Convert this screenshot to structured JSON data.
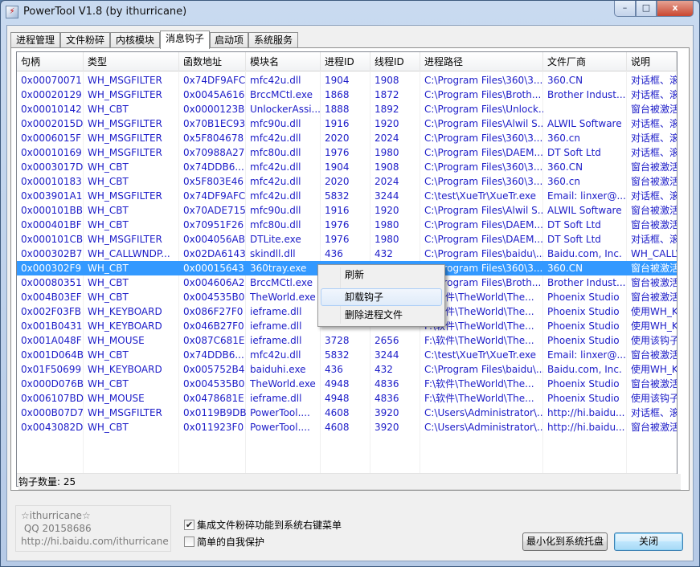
{
  "window": {
    "title": "PowerTool V1.8 (by ithurricane)",
    "app_icon": "app-icon",
    "min": "–",
    "max": "□",
    "close": "x"
  },
  "tabs": [
    "进程管理",
    "文件粉碎",
    "内核模块",
    "消息钩子",
    "启动项",
    "系统服务"
  ],
  "active_tab": 3,
  "columns": [
    "句柄",
    "类型",
    "函数地址",
    "模块名",
    "进程ID",
    "线程ID",
    "进程路径",
    "文件厂商",
    "说明"
  ],
  "rows": [
    [
      "0x00070071",
      "WH_MSGFILTER",
      "0x74DF9AFC",
      "mfc42u.dll",
      "1904",
      "1908",
      "C:\\Program Files\\360\\3...",
      "360.CN",
      "对话框、滚"
    ],
    [
      "0x00020129",
      "WH_MSGFILTER",
      "0x0045A616",
      "BrccMCtl.exe",
      "1868",
      "1872",
      "C:\\Program Files\\Broth...",
      "Brother Indust...",
      "对话框、滚"
    ],
    [
      "0x00010142",
      "WH_CBT",
      "0x0000123B",
      "UnlockerAssi...",
      "1888",
      "1892",
      "C:\\Program Files\\Unlock...",
      "",
      "窗台被激活"
    ],
    [
      "0x0002015D",
      "WH_MSGFILTER",
      "0x70B1EC93",
      "mfc90u.dll",
      "1916",
      "1920",
      "C:\\Program Files\\Alwil S...",
      "ALWIL Software",
      "对话框、滚"
    ],
    [
      "0x0006015F",
      "WH_MSGFILTER",
      "0x5F804678",
      "mfc42u.dll",
      "2020",
      "2024",
      "C:\\Program Files\\360\\3...",
      "360.cn",
      "对话框、滚"
    ],
    [
      "0x00010169",
      "WH_MSGFILTER",
      "0x70988A27",
      "mfc80u.dll",
      "1976",
      "1980",
      "C:\\Program Files\\DAEM...",
      "DT Soft Ltd",
      "对话框、滚"
    ],
    [
      "0x0003017D",
      "WH_CBT",
      "0x74DDB6...",
      "mfc42u.dll",
      "1904",
      "1908",
      "C:\\Program Files\\360\\3...",
      "360.CN",
      "窗台被激活"
    ],
    [
      "0x00010183",
      "WH_CBT",
      "0x5F803E46",
      "mfc42u.dll",
      "2020",
      "2024",
      "C:\\Program Files\\360\\3...",
      "360.cn",
      "窗台被激活"
    ],
    [
      "0x003901A1",
      "WH_MSGFILTER",
      "0x74DF9AFC",
      "mfc42u.dll",
      "5832",
      "3244",
      "C:\\test\\XueTr\\XueTr.exe",
      "Email: linxer@...",
      "对话框、滚"
    ],
    [
      "0x000101BB",
      "WH_CBT",
      "0x70ADE715",
      "mfc90u.dll",
      "1916",
      "1920",
      "C:\\Program Files\\Alwil S...",
      "ALWIL Software",
      "窗台被激活"
    ],
    [
      "0x000401BF",
      "WH_CBT",
      "0x70951F26",
      "mfc80u.dll",
      "1976",
      "1980",
      "C:\\Program Files\\DAEM...",
      "DT Soft Ltd",
      "窗台被激活"
    ],
    [
      "0x000101CB",
      "WH_MSGFILTER",
      "0x004056AB",
      "DTLite.exe",
      "1976",
      "1980",
      "C:\\Program Files\\DAEM...",
      "DT Soft Ltd",
      "对话框、滚"
    ],
    [
      "0x000302B7",
      "WH_CALLWNDP...",
      "0x02DA6143",
      "skindll.dll",
      "436",
      "432",
      "C:\\Program Files\\baidu\\...",
      "Baidu.com, Inc.",
      "WH_CALLW"
    ],
    [
      "0x000302F9",
      "WH_CBT",
      "0x00015643",
      "360tray.exe",
      "1904",
      "1908",
      "C:\\Program Files\\360\\3...",
      "360.CN",
      "窗台被激活"
    ],
    [
      "0x00080351",
      "WH_CBT",
      "0x004606A2",
      "BrccMCtl.exe",
      "",
      "",
      "C:\\Program Files\\Broth...",
      "Brother Indust...",
      "窗台被激活"
    ],
    [
      "0x004B03EF",
      "WH_CBT",
      "0x004535B0",
      "TheWorld.exe",
      "",
      "",
      "F:\\软件\\TheWorld\\The...",
      "Phoenix Studio",
      "窗台被激活"
    ],
    [
      "0x002F03FB",
      "WH_KEYBOARD",
      "0x086F27F0",
      "ieframe.dll",
      "",
      "",
      "F:\\软件\\TheWorld\\The...",
      "Phoenix Studio",
      "使用WH_K"
    ],
    [
      "0x001B0431",
      "WH_KEYBOARD",
      "0x046B27F0",
      "ieframe.dll",
      "",
      "",
      "F:\\软件\\TheWorld\\The...",
      "Phoenix Studio",
      "使用WH_K"
    ],
    [
      "0x001A048F",
      "WH_MOUSE",
      "0x087C681E",
      "ieframe.dll",
      "3728",
      "2656",
      "F:\\软件\\TheWorld\\The...",
      "Phoenix Studio",
      "使用该钩子"
    ],
    [
      "0x001D064B",
      "WH_CBT",
      "0x74DDB6...",
      "mfc42u.dll",
      "5832",
      "3244",
      "C:\\test\\XueTr\\XueTr.exe",
      "Email: linxer@...",
      "窗台被激活"
    ],
    [
      "0x01F50699",
      "WH_KEYBOARD",
      "0x005752B4",
      "baiduhi.exe",
      "436",
      "432",
      "C:\\Program Files\\baidu\\...",
      "Baidu.com, Inc.",
      "使用WH_K"
    ],
    [
      "0x000D076B",
      "WH_CBT",
      "0x004535B0",
      "TheWorld.exe",
      "4948",
      "4836",
      "F:\\软件\\TheWorld\\The...",
      "Phoenix Studio",
      "窗台被激活"
    ],
    [
      "0x006107BD",
      "WH_MOUSE",
      "0x0478681E",
      "ieframe.dll",
      "4948",
      "4836",
      "F:\\软件\\TheWorld\\The...",
      "Phoenix Studio",
      "使用该钩子"
    ],
    [
      "0x000B07D7",
      "WH_MSGFILTER",
      "0x0119B9DB",
      "PowerTool....",
      "4608",
      "3920",
      "C:\\Users\\Administrator\\...",
      "http://hi.baidu...",
      "对话框、滚"
    ],
    [
      "0x0043082D",
      "WH_CBT",
      "0x011923F0",
      "PowerTool....",
      "4608",
      "3920",
      "C:\\Users\\Administrator\\...",
      "http://hi.baidu...",
      "窗台被激活"
    ]
  ],
  "selected_row": 13,
  "context_menu": {
    "items": [
      "刷新",
      "卸载钩子",
      "删除进程文件"
    ],
    "hover_index": 1
  },
  "status": {
    "text": "钩子数量: 25"
  },
  "info": {
    "line1": "☆ithurricane☆",
    "line2": " QQ 20158686",
    "line3": "http://hi.baidu.com/ithurricane"
  },
  "options": {
    "shred_menu_label": "集成文件粉碎功能到系统右键菜单",
    "shred_menu_checked": true,
    "self_protect_label": "简单的自我保护",
    "self_protect_checked": false
  },
  "buttons": {
    "minimize_tray": "最小化到系统托盘",
    "close": "关闭"
  }
}
